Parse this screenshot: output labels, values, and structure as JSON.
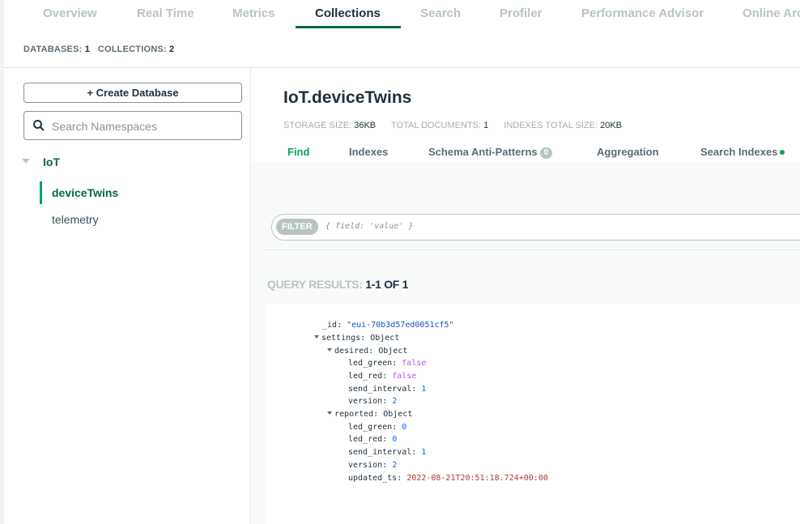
{
  "tabs": [
    "Overview",
    "Real Time",
    "Metrics",
    "Collections",
    "Search",
    "Profiler",
    "Performance Advisor",
    "Online Archive"
  ],
  "active_tab": "Collections",
  "counts": {
    "databases_label": "DATABASES:",
    "databases_value": "1",
    "collections_label": "COLLECTIONS:",
    "collections_value": "2"
  },
  "sidebar": {
    "create_button": "+ Create Database",
    "search_placeholder": "Search Namespaces",
    "database": "IoT",
    "collections": [
      "deviceTwins",
      "telemetry"
    ]
  },
  "main": {
    "namespace": "IoT.deviceTwins",
    "stats": {
      "storage_label": "STORAGE SIZE:",
      "storage_value": "36KB",
      "docs_label": "TOTAL DOCUMENTS:",
      "docs_value": "1",
      "indexes_label": "INDEXES TOTAL SIZE:",
      "indexes_value": "20KB"
    },
    "subtabs": [
      "Find",
      "Indexes",
      "Schema Anti-Patterns",
      "Aggregation",
      "Search Indexes"
    ],
    "schema_badge": "0",
    "filter_label": "FILTER",
    "filter_placeholder": "{ field: 'value' }",
    "query_results_label": "QUERY RESULTS:",
    "query_results_value": "1-1 OF 1"
  },
  "document": {
    "id_key": "_id",
    "id_value": "\"eui-70b3d57ed0051cf5\"",
    "settings_key": "settings",
    "object_type": "Object",
    "desired_key": "desired",
    "desired": {
      "led_green": "false",
      "led_red": "false",
      "send_interval": "1",
      "version": "2"
    },
    "reported_key": "reported",
    "reported": {
      "led_green": "0",
      "led_red": "0",
      "send_interval": "1",
      "version": "2",
      "updated_ts": "2022-08-21T20:51:18.724+00:00"
    }
  },
  "colors": {
    "accent": "#00684a",
    "accent_bright": "#00a35c",
    "string": "#1254b7",
    "boolean": "#b45af2",
    "date": "#b13b2f"
  }
}
